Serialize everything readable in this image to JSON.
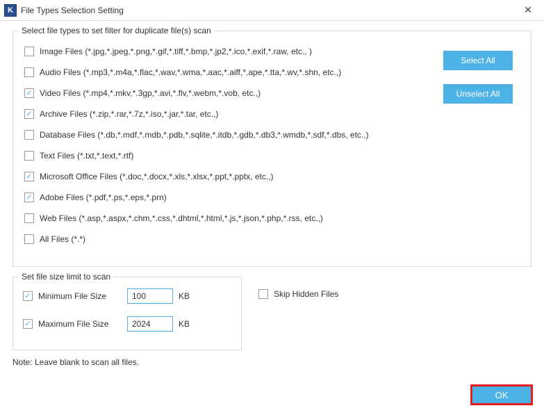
{
  "window": {
    "title": "File Types Selection Setting",
    "icon_letter": "K"
  },
  "filetypes_group": {
    "title": "Select file types to set filter for duplicate file(s) scan",
    "items": [
      {
        "label": "Image Files  (*.jpg,*.jpeg,*.png,*.gif,*.tiff,*.bmp,*.jp2,*.ico,*.exif,*.raw, etc., )",
        "checked": false
      },
      {
        "label": "Audio Files (*.mp3,*.m4a,*.flac,*.wav,*.wma,*.aac,*.aiff,*.ape,*.tta,*.wv,*.shn, etc.,)",
        "checked": false
      },
      {
        "label": "Video Files (*.mp4,*.mkv,*.3gp,*.avi,*.flv,*.webm,*.vob, etc.,)",
        "checked": true
      },
      {
        "label": "Archive Files (*.zip,*.rar,*.7z,*.iso,*.jar,*.tar, etc.,)",
        "checked": true
      },
      {
        "label": "Database Files (*.db,*.mdf,*.mdb,*.pdb,*.sqlite,*.itdb,*.gdb,*.db3,*.wmdb,*.sdf,*.dbs, etc.,)",
        "checked": false
      },
      {
        "label": "Text Files (*.txt,*.text,*.rtf)",
        "checked": false
      },
      {
        "label": "Microsoft Office Files (*.doc,*.docx,*.xls,*.xlsx,*.ppt,*.pptx, etc.,)",
        "checked": true
      },
      {
        "label": "Adobe Files (*.pdf,*.ps,*.eps,*.prn)",
        "checked": true
      },
      {
        "label": "Web Files (*.asp,*.aspx,*.chm,*.css,*.dhtml,*.html,*.js,*.json,*.php,*.rss, etc.,)",
        "checked": false
      },
      {
        "label": "All Files (*.*)",
        "checked": false
      }
    ],
    "select_all": "Select All",
    "unselect_all": "Unselect All"
  },
  "size_group": {
    "title": "Set file size limit to scan",
    "min_checked": true,
    "min_label": "Minimum File Size",
    "min_value": "100",
    "max_checked": true,
    "max_label": "Maximum File Size",
    "max_value": "2024",
    "unit": "KB"
  },
  "skip_hidden": {
    "checked": false,
    "label": "Skip Hidden Files"
  },
  "note": "Note: Leave blank to scan all files.",
  "ok": "OK"
}
